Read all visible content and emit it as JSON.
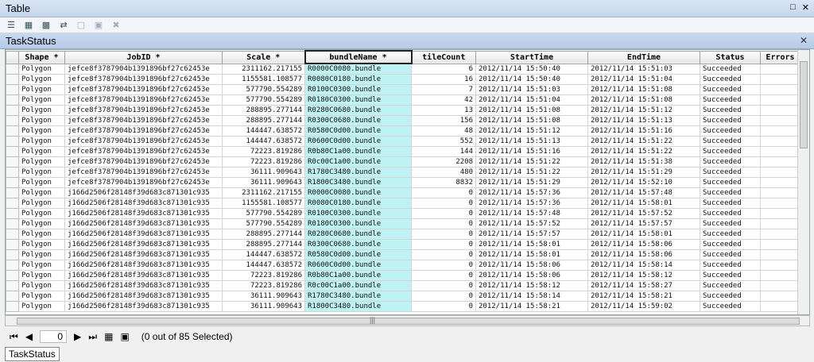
{
  "window": {
    "title": "Table"
  },
  "table_tab": {
    "title": "TaskStatus"
  },
  "bottom_tab": {
    "label": "TaskStatus"
  },
  "nav": {
    "current": "0",
    "status": "(0 out of 85 Selected)"
  },
  "columns": [
    "Shape *",
    "JobID *",
    "Scale *",
    "bundleName *",
    "tileCount",
    "StartTime",
    "EndTime",
    "Status",
    "Errors"
  ],
  "rows": [
    [
      "Polygon",
      "jefce8f3787904b1391896bf27c62453e",
      "2311162.217155",
      "R0000C0080.bundle",
      "6",
      "2012/11/14 15:50:40",
      "2012/11/14 15:51:03",
      "Succeeded",
      ""
    ],
    [
      "Polygon",
      "jefce8f3787904b1391896bf27c62453e",
      "1155581.108577",
      "R0080C0180.bundle",
      "16",
      "2012/11/14 15:50:40",
      "2012/11/14 15:51:04",
      "Succeeded",
      ""
    ],
    [
      "Polygon",
      "jefce8f3787904b1391896bf27c62453e",
      "577790.554289",
      "R0100C0300.bundle",
      "7",
      "2012/11/14 15:51:03",
      "2012/11/14 15:51:08",
      "Succeeded",
      ""
    ],
    [
      "Polygon",
      "jefce8f3787904b1391896bf27c62453e",
      "577790.554289",
      "R0180C0300.bundle",
      "42",
      "2012/11/14 15:51:04",
      "2012/11/14 15:51:08",
      "Succeeded",
      ""
    ],
    [
      "Polygon",
      "jefce8f3787904b1391896bf27c62453e",
      "288895.277144",
      "R0280C0680.bundle",
      "13",
      "2012/11/14 15:51:08",
      "2012/11/14 15:51:12",
      "Succeeded",
      ""
    ],
    [
      "Polygon",
      "jefce8f3787904b1391896bf27c62453e",
      "288895.277144",
      "R0300C0680.bundle",
      "156",
      "2012/11/14 15:51:08",
      "2012/11/14 15:51:13",
      "Succeeded",
      ""
    ],
    [
      "Polygon",
      "jefce8f3787904b1391896bf27c62453e",
      "144447.638572",
      "R0580C0d00.bundle",
      "48",
      "2012/11/14 15:51:12",
      "2012/11/14 15:51:16",
      "Succeeded",
      ""
    ],
    [
      "Polygon",
      "jefce8f3787904b1391896bf27c62453e",
      "144447.638572",
      "R0600C0d00.bundle",
      "552",
      "2012/11/14 15:51:13",
      "2012/11/14 15:51:22",
      "Succeeded",
      ""
    ],
    [
      "Polygon",
      "jefce8f3787904b1391896bf27c62453e",
      "72223.819286",
      "R0b80C1a00.bundle",
      "144",
      "2012/11/14 15:51:16",
      "2012/11/14 15:51:22",
      "Succeeded",
      ""
    ],
    [
      "Polygon",
      "jefce8f3787904b1391896bf27c62453e",
      "72223.819286",
      "R0c00C1a00.bundle",
      "2208",
      "2012/11/14 15:51:22",
      "2012/11/14 15:51:38",
      "Succeeded",
      ""
    ],
    [
      "Polygon",
      "jefce8f3787904b1391896bf27c62453e",
      "36111.909643",
      "R1780C3480.bundle",
      "480",
      "2012/11/14 15:51:22",
      "2012/11/14 15:51:29",
      "Succeeded",
      ""
    ],
    [
      "Polygon",
      "jefce8f3787904b1391896bf27c62453e",
      "36111.909643",
      "R1800C3480.bundle",
      "8832",
      "2012/11/14 15:51:29",
      "2012/11/14 15:52:10",
      "Succeeded",
      ""
    ],
    [
      "Polygon",
      "j166d2506f28148f39d683c871301c935",
      "2311162.217155",
      "R0000C0080.bundle",
      "0",
      "2012/11/14 15:57:36",
      "2012/11/14 15:57:48",
      "Succeeded",
      ""
    ],
    [
      "Polygon",
      "j166d2506f28148f39d683c871301c935",
      "1155581.108577",
      "R0080C0180.bundle",
      "0",
      "2012/11/14 15:57:36",
      "2012/11/14 15:58:01",
      "Succeeded",
      ""
    ],
    [
      "Polygon",
      "j166d2506f28148f39d683c871301c935",
      "577790.554289",
      "R0100C0300.bundle",
      "0",
      "2012/11/14 15:57:48",
      "2012/11/14 15:57:52",
      "Succeeded",
      ""
    ],
    [
      "Polygon",
      "j166d2506f28148f39d683c871301c935",
      "577790.554289",
      "R0180C0300.bundle",
      "0",
      "2012/11/14 15:57:52",
      "2012/11/14 15:57:57",
      "Succeeded",
      ""
    ],
    [
      "Polygon",
      "j166d2506f28148f39d683c871301c935",
      "288895.277144",
      "R0280C0680.bundle",
      "0",
      "2012/11/14 15:57:57",
      "2012/11/14 15:58:01",
      "Succeeded",
      ""
    ],
    [
      "Polygon",
      "j166d2506f28148f39d683c871301c935",
      "288895.277144",
      "R0300C0680.bundle",
      "0",
      "2012/11/14 15:58:01",
      "2012/11/14 15:58:06",
      "Succeeded",
      ""
    ],
    [
      "Polygon",
      "j166d2506f28148f39d683c871301c935",
      "144447.638572",
      "R0580C0d00.bundle",
      "0",
      "2012/11/14 15:58:01",
      "2012/11/14 15:58:06",
      "Succeeded",
      ""
    ],
    [
      "Polygon",
      "j166d2506f28148f39d683c871301c935",
      "144447.638572",
      "R0600C0d00.bundle",
      "0",
      "2012/11/14 15:58:06",
      "2012/11/14 15:58:14",
      "Succeeded",
      ""
    ],
    [
      "Polygon",
      "j166d2506f28148f39d683c871301c935",
      "72223.819286",
      "R0b80C1a00.bundle",
      "0",
      "2012/11/14 15:58:06",
      "2012/11/14 15:58:12",
      "Succeeded",
      ""
    ],
    [
      "Polygon",
      "j166d2506f28148f39d683c871301c935",
      "72223.819286",
      "R0c00C1a00.bundle",
      "0",
      "2012/11/14 15:58:12",
      "2012/11/14 15:58:27",
      "Succeeded",
      ""
    ],
    [
      "Polygon",
      "j166d2506f28148f39d683c871301c935",
      "36111.909643",
      "R1780C3480.bundle",
      "0",
      "2012/11/14 15:58:14",
      "2012/11/14 15:58:21",
      "Succeeded",
      ""
    ],
    [
      "Polygon",
      "j166d2506f28148f39d683c871301c935",
      "36111.909643",
      "R1800C3480.bundle",
      "0",
      "2012/11/14 15:58:21",
      "2012/11/14 15:59:02",
      "Succeeded",
      ""
    ]
  ]
}
